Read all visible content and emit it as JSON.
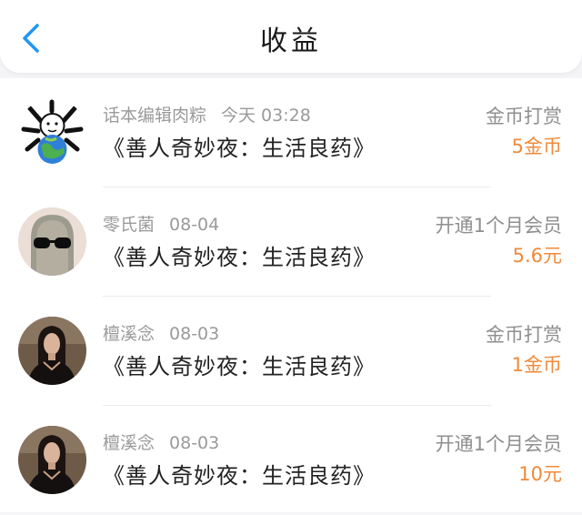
{
  "header": {
    "title": "收益"
  },
  "colors": {
    "accent": "#2196f3",
    "amount": "#f08a3a"
  },
  "records": [
    {
      "avatar_icon": "meme-globe-avatar",
      "name": "话本编辑肉粽",
      "time": "今天 03:28",
      "work": "《善人奇妙夜：生活良药》",
      "type": "金币打赏",
      "amount": "5金币"
    },
    {
      "avatar_icon": "ghost-sunglasses-avatar",
      "name": "零氏菌",
      "time": "08-04",
      "work": "《善人奇妙夜：生活良药》",
      "type": "开通1个月会员",
      "amount": "5.6元"
    },
    {
      "avatar_icon": "woman-portrait-avatar",
      "name": "檀溪念",
      "time": "08-03",
      "work": "《善人奇妙夜：生活良药》",
      "type": "金币打赏",
      "amount": "1金币"
    },
    {
      "avatar_icon": "woman-portrait-avatar",
      "name": "檀溪念",
      "time": "08-03",
      "work": "《善人奇妙夜：生活良药》",
      "type": "开通1个月会员",
      "amount": "10元"
    }
  ]
}
